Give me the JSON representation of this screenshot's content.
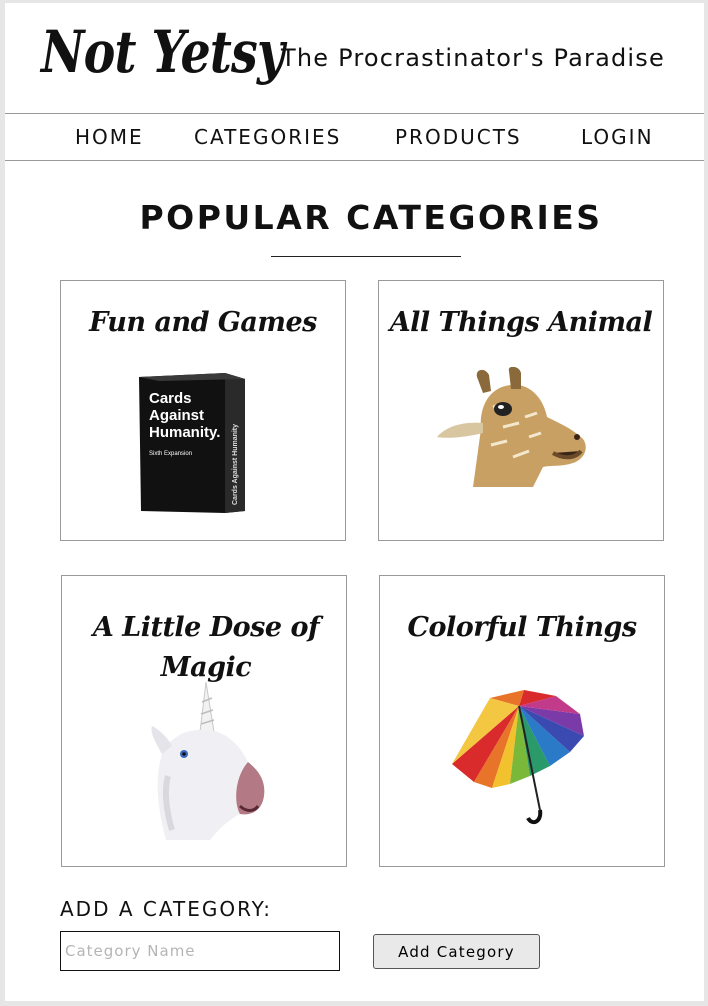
{
  "header": {
    "brand": "Not Yetsy",
    "tagline": "The Procrastinator's Paradise"
  },
  "nav": {
    "items": [
      {
        "label": "HOME"
      },
      {
        "label": "CATEGORIES"
      },
      {
        "label": "PRODUCTS"
      },
      {
        "label": "LOGIN"
      }
    ]
  },
  "main": {
    "section_title": "POPULAR CATEGORIES",
    "cards": [
      {
        "title": "Fun and Games",
        "image": "cards-against-humanity-box"
      },
      {
        "title": "All Things Animal",
        "image": "giraffe-mask"
      },
      {
        "title": "A Little Dose of Magic",
        "image": "unicorn-mask"
      },
      {
        "title": "Colorful Things",
        "image": "rainbow-umbrella"
      }
    ]
  },
  "add_category": {
    "label": "ADD A CATEGORY:",
    "input_placeholder": "Category Name",
    "input_value": "",
    "button_label": "Add Category"
  },
  "product_box_text": {
    "line1": "Cards",
    "line2": "Against",
    "line3": "Humanity.",
    "line4": "Sixth Expansion",
    "spine": "Cards Against Humanity"
  }
}
